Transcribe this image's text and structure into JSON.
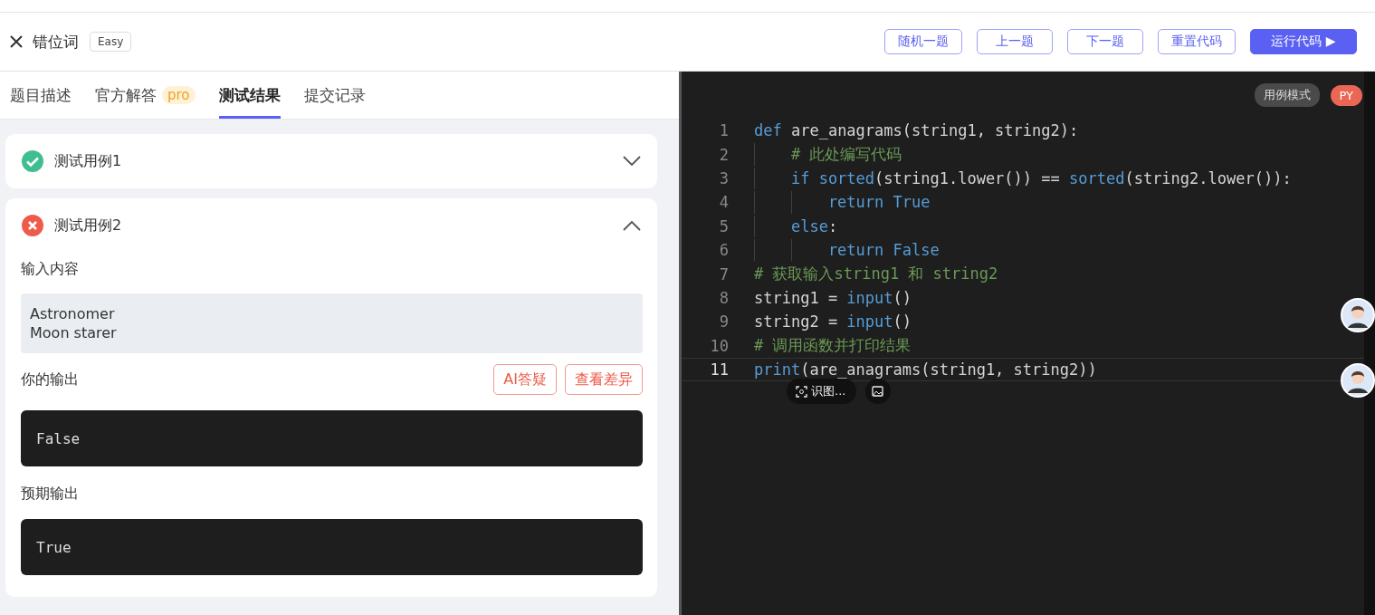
{
  "header": {
    "title": "错位词",
    "difficulty": "Easy",
    "buttons": [
      {
        "label": "随机一题",
        "kind": "outline"
      },
      {
        "label": "上一题",
        "kind": "outline"
      },
      {
        "label": "下一题",
        "kind": "outline"
      },
      {
        "label": "重置代码",
        "kind": "outline"
      },
      {
        "label": "运行代码 ▶",
        "kind": "primary"
      }
    ]
  },
  "tabs": [
    {
      "label": "题目描述",
      "selected": false
    },
    {
      "label": "官方解答",
      "badge": "pro",
      "selected": false
    },
    {
      "label": "测试结果",
      "selected": true
    },
    {
      "label": "提交记录",
      "selected": false
    }
  ],
  "test_cases": [
    {
      "title": "测试用例1",
      "passed": true,
      "expanded": false
    },
    {
      "title": "测试用例2",
      "passed": false,
      "expanded": true,
      "input_label": "输入内容",
      "input_lines": [
        "Astronomer",
        "Moon starer"
      ],
      "output_label": "你的输出",
      "output_actions": [
        "AI答疑",
        "查看差异"
      ],
      "output": "False",
      "expected_label": "预期输出",
      "expected": "True"
    }
  ],
  "editor": {
    "mode_badge": "用例模式",
    "language": "PY",
    "lines": [
      {
        "number": "1",
        "tokens": [
          {
            "text": "def",
            "kind": "kw"
          },
          {
            "text": " are_anagrams(string1, string2):",
            "kind": "plain"
          }
        ]
      },
      {
        "number": "2",
        "tokens": [
          {
            "text": "    # 此处编写代码",
            "kind": "comment"
          }
        ]
      },
      {
        "number": "3",
        "tokens": [
          {
            "text": "    if sorted",
            "kind": "kw"
          },
          {
            "text": "(string1.lower()) == ",
            "kind": "plain"
          },
          {
            "text": "sorted",
            "kind": "kw"
          },
          {
            "text": "(string2.lower()):",
            "kind": "plain"
          }
        ]
      },
      {
        "number": "4",
        "tokens": [
          {
            "text": "        return True",
            "kind": "kw"
          }
        ]
      },
      {
        "number": "5",
        "tokens": [
          {
            "text": "    else",
            "kind": "kw"
          },
          {
            "text": ":",
            "kind": "plain"
          }
        ]
      },
      {
        "number": "6",
        "tokens": [
          {
            "text": "        return False",
            "kind": "kw"
          }
        ]
      },
      {
        "number": "7",
        "tokens": [
          {
            "text": "# 获取输入string1 和 string2",
            "kind": "comment"
          }
        ]
      },
      {
        "number": "8",
        "tokens": [
          {
            "text": "string1 = ",
            "kind": "plain"
          },
          {
            "text": "input",
            "kind": "kw"
          },
          {
            "text": "()",
            "kind": "plain"
          }
        ]
      },
      {
        "number": "9",
        "tokens": [
          {
            "text": "string2 = ",
            "kind": "plain"
          },
          {
            "text": "input",
            "kind": "kw"
          },
          {
            "text": "()",
            "kind": "plain"
          }
        ]
      },
      {
        "number": "10",
        "tokens": [
          {
            "text": "# 调用函数并打印结果",
            "kind": "comment"
          }
        ]
      },
      {
        "number": "11",
        "current": true,
        "tokens": [
          {
            "text": "print",
            "kind": "kw"
          },
          {
            "text": "(are_anagrams(string1, string2))",
            "kind": "plain"
          }
        ]
      }
    ],
    "overlay_toolbar": {
      "label": "识图..."
    }
  }
}
